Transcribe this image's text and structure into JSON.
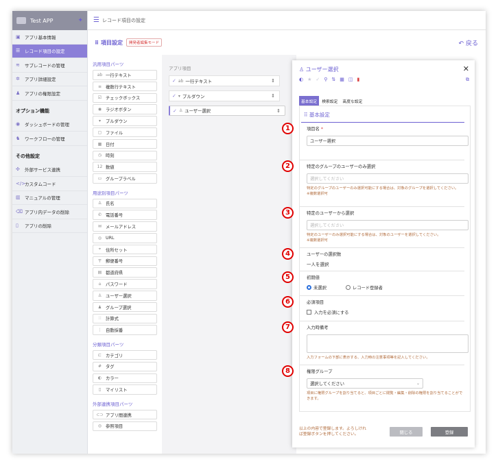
{
  "app": {
    "name": "Test APP",
    "page_title": "レコード項目の設定"
  },
  "sidebar": {
    "items": [
      {
        "icon": "info-icon",
        "glyph": "▣",
        "label": "アプリ基本情報",
        "active": false
      },
      {
        "icon": "list-icon",
        "glyph": "☰",
        "label": "レコード項目の設定",
        "active": true
      },
      {
        "icon": "layers-icon",
        "glyph": "≋",
        "label": "サブレコードの管理",
        "active": false
      },
      {
        "icon": "gear-icon",
        "glyph": "✲",
        "label": "アプリ詳細設定",
        "active": false
      },
      {
        "icon": "users-icon",
        "glyph": "♟",
        "label": "アプリの権限設定",
        "active": false
      }
    ],
    "option_heading": "オプション機能",
    "option_items": [
      {
        "icon": "dashboard-icon",
        "glyph": "◉",
        "label": "ダッシュボードの管理"
      },
      {
        "icon": "workflow-icon",
        "glyph": "♞",
        "label": "ワークフローの管理"
      }
    ],
    "other_heading": "その他設定",
    "other_items": [
      {
        "icon": "puzzle-icon",
        "glyph": "✣",
        "label": "外部サービス連携"
      },
      {
        "icon": "code-icon",
        "glyph": "</>",
        "label": "カスタムコード"
      },
      {
        "icon": "book-icon",
        "glyph": "▥",
        "label": "マニュアルの管理"
      },
      {
        "icon": "erase-icon",
        "glyph": "⌫",
        "label": "アプリ内データの削除"
      },
      {
        "icon": "trash-icon",
        "glyph": "▯",
        "label": "アプリの削除"
      }
    ]
  },
  "section": {
    "title": "項目設定",
    "mode_badge": "開発者編集モード",
    "back_label": "戻る"
  },
  "parts": {
    "general_heading": "汎用項目パーツ",
    "general": [
      {
        "icon": "text-line-icon",
        "glyph": "ab",
        "label": "一行テキスト"
      },
      {
        "icon": "text-multi-icon",
        "glyph": "≡",
        "label": "複数行テキスト"
      },
      {
        "icon": "checkbox-icon",
        "glyph": "☑",
        "label": "チェックボックス"
      },
      {
        "icon": "radio-icon",
        "glyph": "◉",
        "label": "ラジオボタン"
      },
      {
        "icon": "dropdown-icon",
        "glyph": "▾",
        "label": "プルダウン"
      },
      {
        "icon": "file-icon",
        "glyph": "▢",
        "label": "ファイル"
      },
      {
        "icon": "calendar-icon",
        "glyph": "▦",
        "label": "日付"
      },
      {
        "icon": "clock-icon",
        "glyph": "◷",
        "label": "時刻"
      },
      {
        "icon": "number-icon",
        "glyph": "12",
        "label": "数値"
      },
      {
        "icon": "folder-icon",
        "glyph": "▭",
        "label": "グループラベル"
      }
    ],
    "purpose_heading": "用途別項目パーツ",
    "purpose": [
      {
        "icon": "person-icon",
        "glyph": "♙",
        "label": "氏名"
      },
      {
        "icon": "phone-icon",
        "glyph": "✆",
        "label": "電話番号"
      },
      {
        "icon": "mail-icon",
        "glyph": "✉",
        "label": "メールアドレス"
      },
      {
        "icon": "globe-icon",
        "glyph": "◎",
        "label": "URL"
      },
      {
        "icon": "location-icon",
        "glyph": "⌖",
        "label": "住所セット"
      },
      {
        "icon": "postal-icon",
        "glyph": "〒",
        "label": "郵便番号"
      },
      {
        "icon": "prefecture-icon",
        "glyph": "▤",
        "label": "都道府県"
      },
      {
        "icon": "lock-icon",
        "glyph": "⌂",
        "label": "パスワード"
      },
      {
        "icon": "user-icon",
        "glyph": "♙",
        "label": "ユーザー選択"
      },
      {
        "icon": "group-icon",
        "glyph": "♟",
        "label": "グループ選択"
      },
      {
        "icon": "formula-icon",
        "glyph": "∷",
        "label": "計算式"
      },
      {
        "icon": "autonumber-icon",
        "glyph": "⋮",
        "label": "自動採番"
      }
    ],
    "category_heading": "分類項目パーツ",
    "category": [
      {
        "icon": "category-icon",
        "glyph": "⊏",
        "label": "カテゴリ"
      },
      {
        "icon": "tag-icon",
        "glyph": "#",
        "label": "タグ"
      },
      {
        "icon": "palette-icon",
        "glyph": "◐",
        "label": "カラー"
      },
      {
        "icon": "bookmark-icon",
        "glyph": "▯",
        "label": "マイリスト"
      }
    ],
    "link_heading": "外部連携項目パーツ",
    "link": [
      {
        "icon": "link-icon",
        "glyph": "⊂⊃",
        "label": "アプリ間連携"
      },
      {
        "icon": "eye-icon",
        "glyph": "◎",
        "label": "参照項目"
      }
    ]
  },
  "app_items": {
    "label": "アプリ項目",
    "items": [
      {
        "icon": "text-line-icon",
        "glyph": "ab",
        "label": "一行テキスト",
        "selected": false
      },
      {
        "icon": "dropdown-icon",
        "glyph": "▾",
        "label": "プルダウン",
        "selected": false
      },
      {
        "icon": "user-icon",
        "glyph": "♙",
        "label": "ユーザー選択",
        "selected": true
      }
    ]
  },
  "panel": {
    "title": "ユーザー選択",
    "tabs": [
      {
        "label": "基本設定",
        "active": true
      },
      {
        "label": "検索設定",
        "active": false
      },
      {
        "label": "高度な設定",
        "active": false
      }
    ],
    "body_title": "基本設定",
    "fields": {
      "name": {
        "num": "1",
        "label": "項目名",
        "required_mark": "*",
        "value": "ユーザー選択"
      },
      "group_only": {
        "num": "2",
        "label": "特定のグループのユーザーのみ選択",
        "placeholder": "選択してください",
        "help": "特定のグループのユーザーのみ選択可能にする場合は、対象のグループを選択してください。",
        "help2": "※複数選択可"
      },
      "users_from": {
        "num": "3",
        "label": "特定のユーザーから選択",
        "placeholder": "選択してください",
        "help": "特定のユーザーのみ選択可能にする場合は、対象のユーザーを選択してください。",
        "help2": "※複数選択可"
      },
      "count": {
        "num": "4",
        "label": "ユーザーの選択数",
        "value": "一人を選択"
      },
      "initial": {
        "num": "5",
        "label": "初期値",
        "opt1": "未選択",
        "opt2": "レコード登録者"
      },
      "required": {
        "num": "6",
        "label": "必須項目",
        "checkbox_label": "入力を必須にする"
      },
      "note": {
        "num": "7",
        "label": "入力時備考",
        "help": "入力フォームの下部に表示する、入力時の注意事項等を記入してください。"
      },
      "perm": {
        "num": "8",
        "label": "権限グループ",
        "select": "選択してください",
        "help": "項目に権限グループを割り当てると、項目ごとに閲覧・編集・削除の権限を割り当てることができます。"
      }
    },
    "footer_text": "以上の内容で登録します。よろしければ登録ボタンを押してください。",
    "close_label": "閉じる",
    "register_label": "登録"
  }
}
